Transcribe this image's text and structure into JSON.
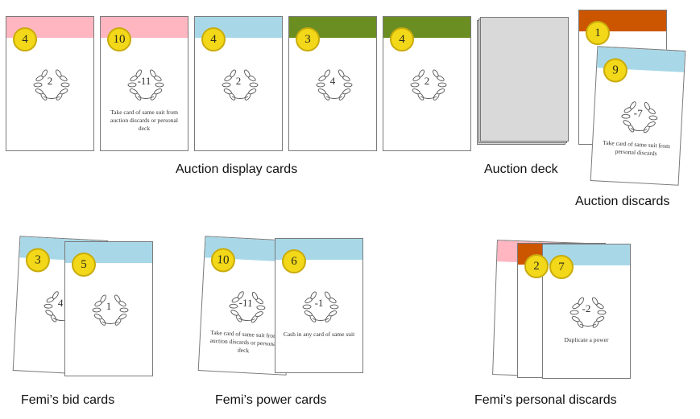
{
  "colors": {
    "pink": "#ffb6c1",
    "blue": "#a8d8e8",
    "green": "#6b8e23",
    "orange": "#cc5500",
    "coin": "#f2d818",
    "deck": "#d9d9d9"
  },
  "auction_display": {
    "label": "Auction display cards",
    "cards": [
      {
        "suit": "pink",
        "cost": "4",
        "score": "2",
        "ability": ""
      },
      {
        "suit": "pink",
        "cost": "10",
        "score": "-11",
        "ability": "Take card of same suit from auction discards or personal deck"
      },
      {
        "suit": "blue",
        "cost": "4",
        "score": "2",
        "ability": ""
      },
      {
        "suit": "green",
        "cost": "3",
        "score": "4",
        "ability": ""
      },
      {
        "suit": "green",
        "cost": "4",
        "score": "2",
        "ability": ""
      }
    ]
  },
  "auction_deck": {
    "label": "Auction deck"
  },
  "auction_discards": {
    "label": "Auction discards",
    "cards": [
      {
        "suit": "orange",
        "cost": "1",
        "score": "",
        "ability": ""
      },
      {
        "suit": "blue",
        "cost": "9",
        "score": "-7",
        "ability": "Take card of same suit from personal discards"
      }
    ]
  },
  "bid_cards": {
    "label": "Femi’s bid cards",
    "cards": [
      {
        "suit": "blue",
        "cost": "3",
        "score": "4",
        "ability": ""
      },
      {
        "suit": "blue",
        "cost": "5",
        "score": "1",
        "ability": ""
      }
    ]
  },
  "power_cards": {
    "label": "Femi’s power cards",
    "cards": [
      {
        "suit": "blue",
        "cost": "10",
        "score": "-11",
        "ability": "Take card of same suit from auction discards or personal deck"
      },
      {
        "suit": "blue",
        "cost": "6",
        "score": "-1",
        "ability": "Cash in any card of same suit"
      }
    ]
  },
  "personal_discards": {
    "label": "Femi’s personal discards",
    "cards": [
      {
        "suit": "pink",
        "cost": "",
        "score": "",
        "ability": ""
      },
      {
        "suit": "orange",
        "cost": "2",
        "score": "",
        "ability": ""
      },
      {
        "suit": "blue",
        "cost": "7",
        "score": "-2",
        "ability": "Duplicate a power"
      }
    ]
  }
}
